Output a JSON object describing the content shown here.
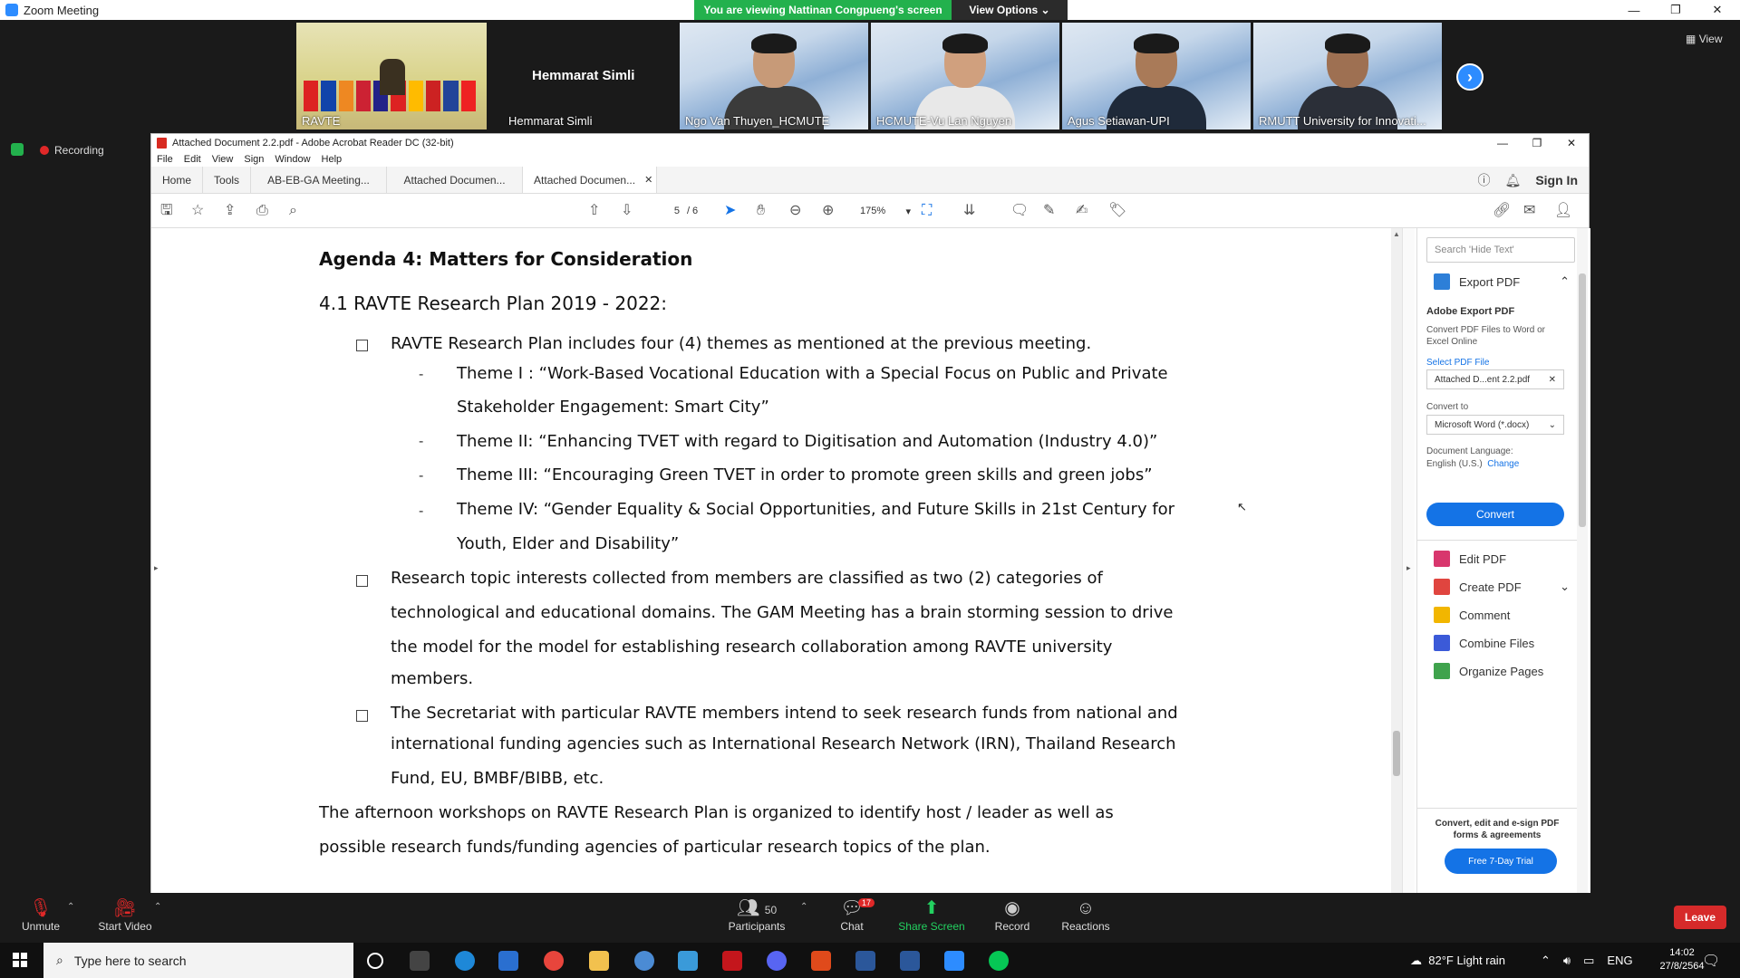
{
  "zoom": {
    "window_title": "Zoom Meeting",
    "viewing_banner": "You are viewing Nattinan Congpueng's screen",
    "view_options": "View Options",
    "view_label": "View",
    "recording": "Recording",
    "main_speaker_name": "Hemmarat Simli",
    "participants": [
      {
        "name": "RAVTE"
      },
      {
        "name": "Hemmarat Simli"
      },
      {
        "name": "Ngo Van Thuyen_HCMUTE"
      },
      {
        "name": "HCMUTE-Vu Lan Nguyen"
      },
      {
        "name": "Agus Setiawan-UPI"
      },
      {
        "name": "RMUTT University for Innovati..."
      }
    ],
    "toolbar": {
      "unmute": "Unmute",
      "start_video": "Start Video",
      "participants": "Participants",
      "participants_count": "50",
      "chat": "Chat",
      "chat_badge": "17",
      "share_screen": "Share Screen",
      "record": "Record",
      "reactions": "Reactions",
      "leave": "Leave"
    }
  },
  "acrobat": {
    "title": "Attached Document 2.2.pdf - Adobe Acrobat Reader DC (32-bit)",
    "menu": [
      "File",
      "Edit",
      "View",
      "Sign",
      "Window",
      "Help"
    ],
    "tabs": {
      "home": "Home",
      "tools": "Tools",
      "tab1": "AB-EB-GA Meeting...",
      "tab2": "Attached Documen...",
      "tab3": "Attached Documen..."
    },
    "sign_in": "Sign In",
    "page_current": "5",
    "page_total": "/ 6",
    "zoom": "175%",
    "document": {
      "heading": "Agenda 4: Matters for Consideration",
      "subheading": "4.1  RAVTE Research Plan 2019 - 2022:",
      "b1": "RAVTE Research Plan includes four (4) themes as mentioned at the previous meeting.",
      "t1a": "Theme I : “Work-Based Vocational Education with a Special Focus on Public and Private",
      "t1b": "Stakeholder Engagement: Smart City”",
      "t2": "Theme II: “Enhancing TVET with regard to Digitisation and Automation (Industry 4.0)”",
      "t3": "Theme III: “Encouraging Green TVET in order to promote green skills and green jobs”",
      "t4a": "Theme IV: “Gender Equality & Social Opportunities, and Future Skills in 21st Century for",
      "t4b": "Youth, Elder and Disability”",
      "b2a": "Research topic interests collected from members are classified as two (2) categories of",
      "b2b": "technological and educational domains. The GAM Meeting has a brain storming session to drive",
      "b2c": "the model for the model for establishing research collaboration among RAVTE university",
      "b2d": "members.",
      "b3a": "The Secretariat with particular RAVTE members intend to seek research funds from national and",
      "b3b": "international funding agencies such as International Research Network (IRN), Thailand Research",
      "b3c": "Fund, EU, BMBF/BIBB,  etc.",
      "p1": "The afternoon workshops on RAVTE Research Plan is organized to identify host / leader as well as",
      "p2": "possible research funds/funding agencies of particular research topics of the plan."
    },
    "right_pane": {
      "search_placeholder": "Search 'Hide Text'",
      "export_pdf": "Export PDF",
      "adobe_export_title": "Adobe Export PDF",
      "export_desc": "Convert PDF Files to Word or Excel Online",
      "select_file": "Select PDF File",
      "file_name": "Attached D...ent 2.2.pdf",
      "convert_to": "Convert to",
      "format": "Microsoft Word (*.docx)",
      "doc_lang_label": "Document Language:",
      "doc_lang": "English (U.S.)",
      "change": "Change",
      "convert_button": "Convert",
      "tools": [
        "Edit PDF",
        "Create PDF",
        "Comment",
        "Combine Files",
        "Organize Pages"
      ],
      "promo": "Convert, edit and e-sign PDF forms & agreements",
      "trial": "Free 7-Day Trial"
    }
  },
  "taskbar": {
    "search_placeholder": "Type here to search",
    "weather": "82°F  Light rain",
    "language": "ENG",
    "time": "14:02",
    "date": "27/8/2564"
  },
  "colors": {
    "zoom_blue": "#2d8cff",
    "banner_green": "#23b14d",
    "acrobat_blue": "#1473e6",
    "leave_red": "#d62a2a"
  }
}
